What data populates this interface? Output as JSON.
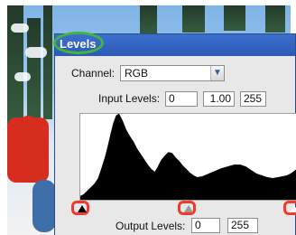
{
  "dialog": {
    "title": "Levels",
    "channel": {
      "label": "Channel:",
      "value": "RGB",
      "icon": "chevron-down-icon"
    },
    "input_levels": {
      "label": "Input Levels:",
      "values": [
        "0",
        "1.00",
        "255"
      ]
    },
    "output_levels": {
      "label": "Output Levels:",
      "values": [
        "0",
        "255"
      ]
    }
  },
  "colors": {
    "title_bar": "#2d5bb7",
    "highlight_ring": "#41b53c",
    "slider_highlight": "#ef3a2d"
  }
}
